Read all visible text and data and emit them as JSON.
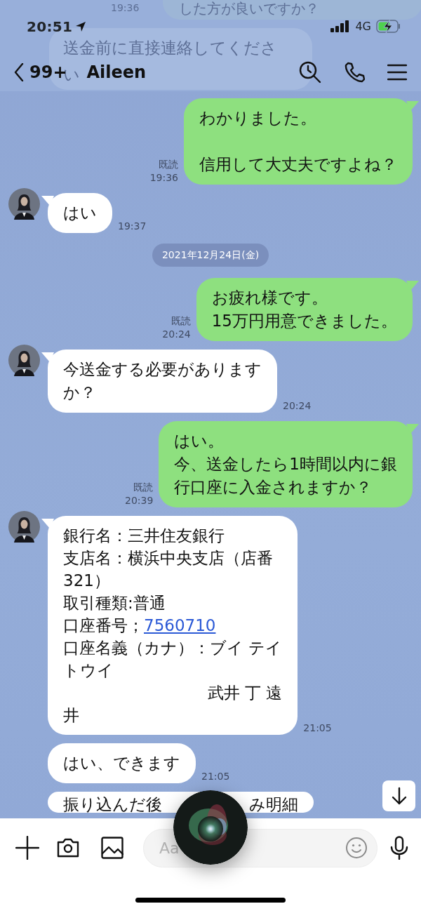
{
  "status_bar": {
    "time": "20:51",
    "network": "4G"
  },
  "behind_header": {
    "top_text": "した方が良いですか？",
    "top_time": "19:36",
    "lines": [
      "送金前に直接連絡してくださ",
      "い"
    ]
  },
  "header": {
    "back_count": "99+",
    "title": "Aileen"
  },
  "messages": [
    {
      "kind": "sent",
      "paragraphs": [
        [
          "わかりました。"
        ],
        [
          "信用して大丈夫ですよね？"
        ]
      ],
      "read": "既読",
      "time": "19:36"
    },
    {
      "kind": "received",
      "avatar": true,
      "paragraphs": [
        [
          "はい"
        ]
      ],
      "time": "19:37"
    },
    {
      "kind": "date",
      "text": "2021年12月24日(金)"
    },
    {
      "kind": "sent",
      "paragraphs": [
        [
          "お疲れ様です。",
          "15万円用意できました。"
        ]
      ],
      "read": "既読",
      "time": "20:24"
    },
    {
      "kind": "received",
      "avatar": true,
      "paragraphs": [
        [
          "今送金する必要があります",
          "か？"
        ]
      ],
      "time": "20:24"
    },
    {
      "kind": "sent",
      "paragraphs": [
        [
          "はい。",
          "今、送金したら1時間以内に銀",
          "行口座に入金されますか？"
        ]
      ],
      "read": "既読",
      "time": "20:39"
    },
    {
      "kind": "received",
      "avatar": true,
      "paragraphs": [
        [
          {
            "text": "銀行名：三井住友銀行"
          },
          {
            "text": "支店名：横浜中央支店（店番"
          },
          {
            "text": "321）"
          },
          {
            "text": "取引種類:普通"
          },
          {
            "text": "口座番号；",
            "link": "7560710"
          },
          {
            "text": "口座名義（カナ）：ブイ テイ"
          },
          {
            "text": "トウイ"
          },
          {
            "text": "武井 丁 遠",
            "right_aligned": true
          },
          {
            "text": "井"
          }
        ]
      ],
      "time": "21:05"
    },
    {
      "kind": "received",
      "avatar": false,
      "paragraphs": [
        [
          "はい、できます"
        ]
      ],
      "time": "21:05"
    },
    {
      "kind": "received",
      "avatar": false,
      "text_parts": [
        "振り込んだ後",
        "み明細"
      ]
    }
  ],
  "composer": {
    "placeholder": "Aa"
  }
}
